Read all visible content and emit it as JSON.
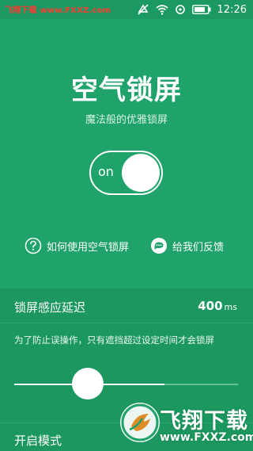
{
  "status_bar": {
    "watermark": "飞翔下载 www.FXXZ.com",
    "time": "12:26",
    "icons": [
      "do-not-disturb-icon",
      "wifi-icon",
      "sync-icon",
      "battery-icon"
    ]
  },
  "app": {
    "title": "空气锁屏",
    "subtitle": "魔法般的优雅锁屏"
  },
  "toggle": {
    "label": "on",
    "state": true
  },
  "links": {
    "help": "如何使用空气锁屏",
    "feedback": "给我们反馈"
  },
  "settings": {
    "delay": {
      "title": "锁屏感应延迟",
      "value": "400",
      "unit": "ms",
      "description": "为了防止误操作，只有遮挡超过设定时间才会锁屏",
      "slider_fraction": 0.33
    },
    "mode": {
      "title": "开启模式"
    }
  },
  "watermark": {
    "title": "飞翔下载",
    "domain": "www.FXXZ.com"
  },
  "colors": {
    "background": "#1fa36a",
    "panel": "#1b975f",
    "watermark_red": "#ff3b30"
  }
}
